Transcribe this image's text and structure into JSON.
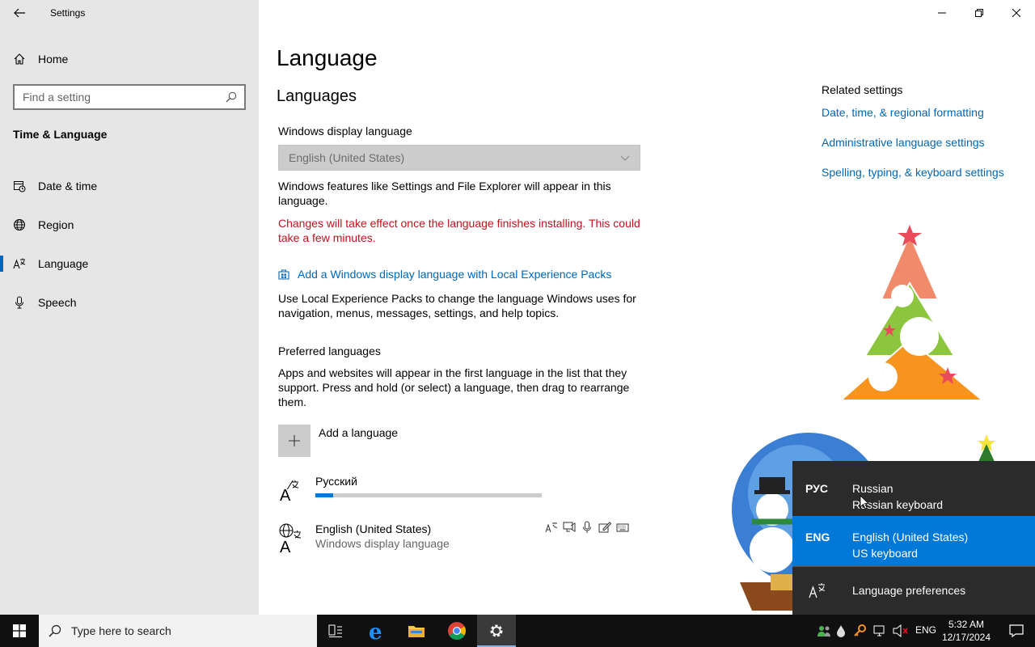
{
  "window": {
    "app_title": "Settings",
    "controls": {
      "minimize": "—",
      "restore": "❐",
      "close": "✕"
    }
  },
  "nav": {
    "home_label": "Home",
    "search_placeholder": "Find a setting",
    "section_title": "Time & Language",
    "items": [
      {
        "label": "Date & time",
        "icon": "calendar-clock-icon"
      },
      {
        "label": "Region",
        "icon": "globe-icon"
      },
      {
        "label": "Language",
        "icon": "language-icon",
        "active": true
      },
      {
        "label": "Speech",
        "icon": "microphone-icon"
      }
    ]
  },
  "main": {
    "title": "Language",
    "languages_heading": "Languages",
    "display_language_label": "Windows display language",
    "display_language_value": "English (United States)",
    "display_language_desc": "Windows features like Settings and File Explorer will appear in this language.",
    "install_warning": "Changes will take effect once the language finishes installing. This could take a few minutes.",
    "add_pack_link": "Add a Windows display language with Local Experience Packs",
    "pack_desc": "Use Local Experience Packs to change the language Windows uses for navigation, menus, messages, settings, and help topics.",
    "preferred_heading": "Preferred languages",
    "preferred_desc": "Apps and websites will appear in the first language in the list that they support. Press and hold (or select) a language, then drag to rearrange them.",
    "add_language_label": "Add a language",
    "preferred_list": [
      {
        "name": "Русский",
        "install_progress": 0.08
      },
      {
        "name": "English (United States)",
        "sub": "Windows display language"
      }
    ]
  },
  "related": {
    "heading": "Related settings",
    "links": [
      "Date, time, & regional formatting",
      "Administrative language settings",
      "Spelling, typing, & keyboard settings"
    ]
  },
  "flyout": {
    "items": [
      {
        "code": "РУС",
        "language": "Russian",
        "keyboard": "Russian keyboard"
      },
      {
        "code": "ENG",
        "language": "English (United States)",
        "keyboard": "US keyboard",
        "selected": true
      }
    ],
    "preferences_label": "Language preferences"
  },
  "taskbar": {
    "search_placeholder": "Type here to search",
    "input_indicator": "ENG",
    "time": "5:32 AM",
    "date": "12/17/2024"
  },
  "colors": {
    "accent": "#0078d7",
    "link": "#0067b8",
    "warning": "#c50f1f",
    "nav_bg": "#e6e6e6",
    "flyout_bg": "#2b2b2b",
    "taskbar_bg": "#101010"
  }
}
